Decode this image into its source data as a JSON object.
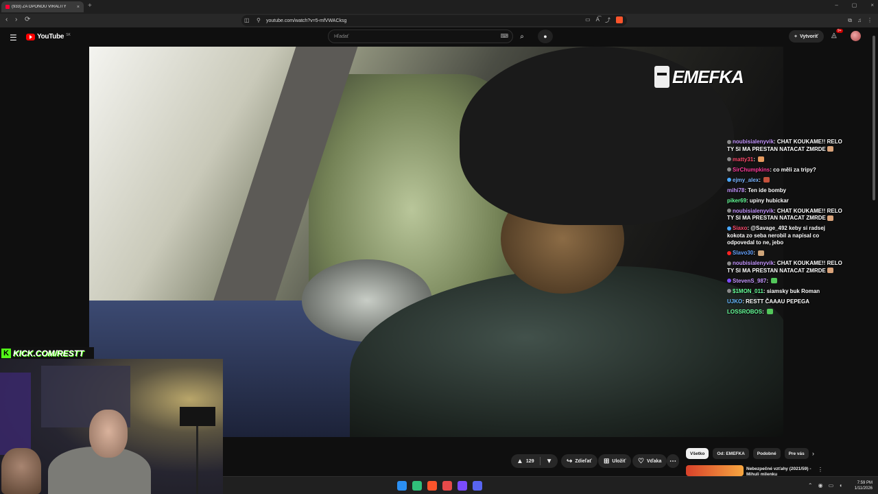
{
  "browser": {
    "tab_title": "(933) ZA OPONOU VIRALITY",
    "tab_close": "×",
    "new_tab": "+",
    "window_controls": [
      "–",
      "▢",
      "×"
    ],
    "url": "youtube.com/watch?v=5-mfVWACksg",
    "back": "‹",
    "forward": "›",
    "reload": "⟳",
    "bookmark_icon": "bookmark-icon",
    "url_icons": [
      "▭",
      "A͡",
      "⤴",
      "♡"
    ],
    "extensions": [
      "⧉",
      "♫",
      "⋮"
    ]
  },
  "youtube": {
    "menu_icon": "☰",
    "logo_text": "YouTube",
    "logo_country": "SK",
    "search_placeholder": "Hľadať",
    "keyboard_icon": "⌨",
    "search_icon": "⌕",
    "mic_icon": "🎤",
    "create_label": "Vytvoriť",
    "create_plus": "+",
    "bell_icon": "🔔",
    "notif_badge": "9+"
  },
  "video": {
    "brand_watermark": "EMEFKA",
    "kick_url": "KICK.COM/RESTT",
    "kick_icon": "K"
  },
  "chat": [
    {
      "user": "noubisialenyvik",
      "text": "CHAT KOUKAME!! RELO TY SI MA PRESTAN NATACAT ZMRDE",
      "user_color": "#c596ff",
      "badge": "#8b8b8b",
      "emote": "#d9a37a"
    },
    {
      "user": "matty31",
      "text": "",
      "user_color": "#ff4b6e",
      "badge": "#8b8b8b",
      "emote": "#e69a5e"
    },
    {
      "user": "SirChumpkins",
      "text": "co měli za tripy?",
      "user_color": "#ff3b9b",
      "badge": "#8b8b8b",
      "emote": ""
    },
    {
      "user": "ejmy_alex",
      "text": "",
      "user_color": "#7ab5ff",
      "badge": "#49a8ff",
      "emote": "#c4513c"
    },
    {
      "user": "mihi78",
      "text": "Ten ide bomby",
      "user_color": "#c596ff",
      "badge": "",
      "emote": ""
    },
    {
      "user": "piker69",
      "text": "upiny hubickar",
      "user_color": "#66ff99",
      "badge": "",
      "emote": ""
    },
    {
      "user": "noubisialenyvik",
      "text": "CHAT KOUKAME!! RELO TY SI MA PRESTAN NATACAT ZMRDE",
      "user_color": "#c596ff",
      "badge": "#8b8b8b",
      "emote": "#d9a37a"
    },
    {
      "user": "Siaxo",
      "text": "@Savage_492 keby si radsej kokota zo seba nerobil a napisal co odpovedal to ne, jebo",
      "user_color": "#ff4b6e",
      "badge": "#49a8ff",
      "emote": ""
    },
    {
      "user": "Slavo30",
      "text": "",
      "user_color": "#66a3ff",
      "badge": "#ff2222",
      "emote": "#cfa67a"
    },
    {
      "user": "noubisialenyvik",
      "text": "CHAT KOUKAME!! RELO TY SI MA PRESTAN NATACAT ZMRDE",
      "user_color": "#c596ff",
      "badge": "#8b8b8b",
      "emote": "#d9a37a"
    },
    {
      "user": "StevenS_987",
      "text": "",
      "user_color": "#c596ff",
      "badge": "#7b4bff",
      "emote": "#53c75b"
    },
    {
      "user": "$1MON_011",
      "text": "siamsky buk Roman",
      "user_color": "#66ff99",
      "badge": "#8b8b8b",
      "emote": ""
    },
    {
      "user": "UJKO",
      "text": "RESTT ČAAAU PEPEGA",
      "user_color": "#66b8ff",
      "badge": "",
      "emote": ""
    },
    {
      "user": "LOSSROBOS",
      "text": "",
      "user_color": "#66ff99",
      "badge": "",
      "emote": "#53c75b"
    }
  ],
  "actions": {
    "like_count": "129",
    "like_icon": "👍",
    "dislike_icon": "👎",
    "share_label": "Zdieľať",
    "share_icon": "↪",
    "save_label": "Uložiť",
    "save_icon": "⊞",
    "thanks_label": "Vďaka",
    "thanks_icon": "♡",
    "more_icon": "⋯"
  },
  "chips": [
    "Všetko",
    "Od: EMEFKA",
    "Podobné",
    "Pre vás"
  ],
  "chip_next": "›",
  "recommendation": {
    "title": "Nebezpečné vzťahy (2021/59) - Mihuli milenku",
    "more_icon": "⋮"
  },
  "taskbar": {
    "app_colors": [
      "#2b8ff2",
      "#30c07a",
      "#fb542b",
      "#e64a4a",
      "#7b4bff",
      "#5865f2"
    ],
    "tray_icons": [
      "⌃",
      "🎤",
      "▭",
      "🔊"
    ],
    "time": "7:59 PM",
    "date": "1/11/2026"
  }
}
